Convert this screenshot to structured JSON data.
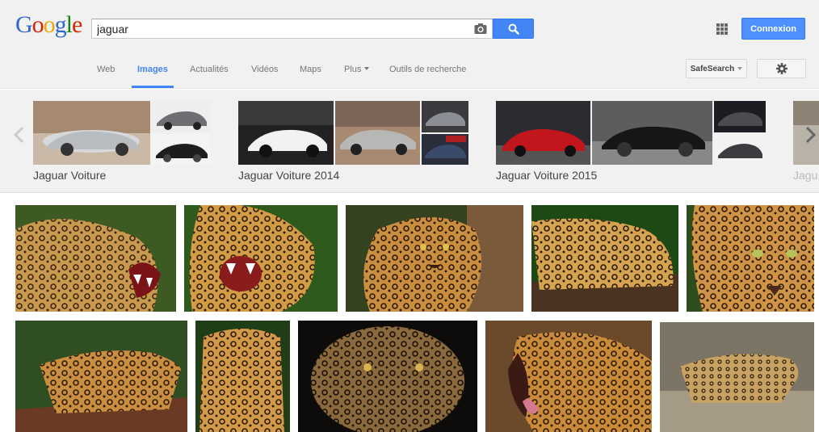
{
  "header": {
    "logo": [
      "G",
      "o",
      "o",
      "g",
      "l",
      "e"
    ],
    "logo_colors": [
      "#3366cc",
      "#dd2200",
      "#eeaa00",
      "#3366cc",
      "#118811",
      "#dd2200"
    ],
    "search_value": "jaguar",
    "signin_label": "Connexion"
  },
  "nav": {
    "items": [
      "Web",
      "Images",
      "Actualités",
      "Vidéos",
      "Maps",
      "Plus",
      "Outils de recherche"
    ],
    "active": "Images",
    "safesearch_label": "SafeSearch"
  },
  "related": [
    {
      "label": "Jaguar Voiture"
    },
    {
      "label": "Jaguar Voiture 2014"
    },
    {
      "label": "Jaguar Voiture 2015"
    },
    {
      "label": "Jagu"
    }
  ],
  "colors": {
    "accent": "#4285f4",
    "button": "#4d90fe"
  }
}
